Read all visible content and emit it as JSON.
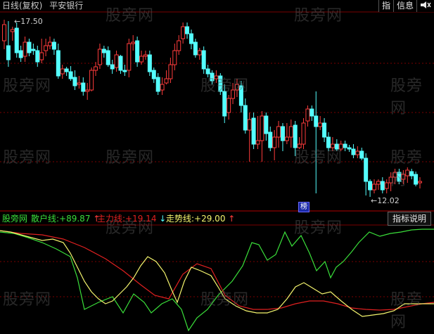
{
  "header": {
    "chart_type": "日线(复权)",
    "stock_name": "平安银行"
  },
  "toolbar": {
    "btn1": "指",
    "btn2": "信息",
    "btn3_icon": "speaker-icon"
  },
  "price": {
    "high_label": "17.50",
    "low_label": "12.02",
    "marker": "榜"
  },
  "indicator": {
    "name": "股旁网",
    "line1_label": "散户线:",
    "line1_value": "+89.87",
    "line1_arrow": "↑",
    "line2_label": "主力线:",
    "line2_value": "+19.14",
    "line2_arrow": "↓",
    "line3_label": "走势线:",
    "line3_value": "+29.00",
    "line3_arrow": "↑",
    "button": "指标说明"
  },
  "watermark": "股旁网",
  "colors": {
    "up": "#ff3c3c",
    "down": "#54ffff",
    "line1": "#3adf3a",
    "line2": "#e02020",
    "line3": "#f5f56e",
    "bg": "#000000",
    "grid": "#7a0000"
  }
}
